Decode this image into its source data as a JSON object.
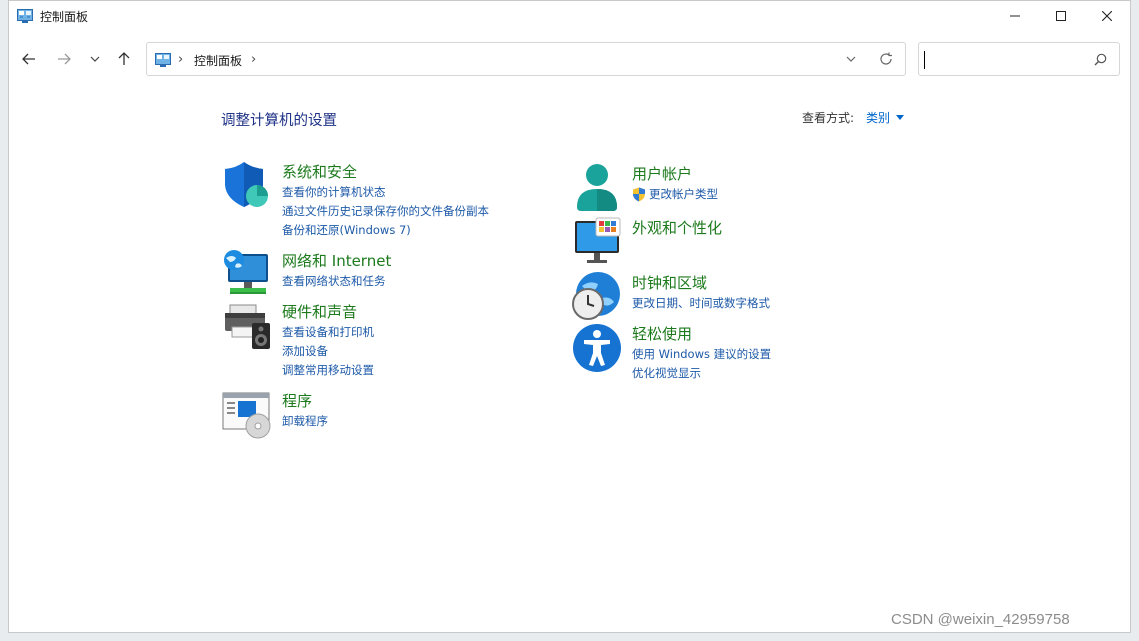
{
  "window": {
    "title": "控制面板"
  },
  "toolbar": {
    "address": {
      "crumb": "控制面板"
    },
    "search": {
      "placeholder": "",
      "value": ""
    }
  },
  "main": {
    "heading": "调整计算机的设置",
    "view_by_label": "查看方式:",
    "view_by_value": "类别"
  },
  "categories": {
    "system_security": {
      "title": "系统和安全",
      "icon": "shield-icon",
      "links": [
        "查看你的计算机状态",
        "通过文件历史记录保存你的文件备份副本",
        "备份和还原(Windows 7)"
      ]
    },
    "network": {
      "title": "网络和 Internet",
      "icon": "network-globe-icon",
      "links": [
        "查看网络状态和任务"
      ]
    },
    "hardware_sound": {
      "title": "硬件和声音",
      "icon": "printer-speaker-icon",
      "links": [
        "查看设备和打印机",
        "添加设备",
        "调整常用移动设置"
      ]
    },
    "programs": {
      "title": "程序",
      "icon": "programs-disc-icon",
      "links": [
        "卸载程序"
      ]
    },
    "user_accounts": {
      "title": "用户帐户",
      "icon": "user-icon",
      "links": [
        "更改帐户类型"
      ]
    },
    "appearance": {
      "title": "外观和个性化",
      "icon": "monitor-personalize-icon",
      "links": []
    },
    "clock_region": {
      "title": "时钟和区域",
      "icon": "clock-globe-icon",
      "links": [
        "更改日期、时间或数字格式"
      ]
    },
    "ease_of_access": {
      "title": "轻松使用",
      "icon": "accessibility-icon",
      "links": [
        "使用 Windows 建议的设置",
        "优化视觉显示"
      ]
    }
  },
  "watermark": "CSDN @weixin_42959758",
  "colors": {
    "category_title": "#1c7a1c",
    "link": "#1e5aa8",
    "heading": "#1e3287"
  }
}
